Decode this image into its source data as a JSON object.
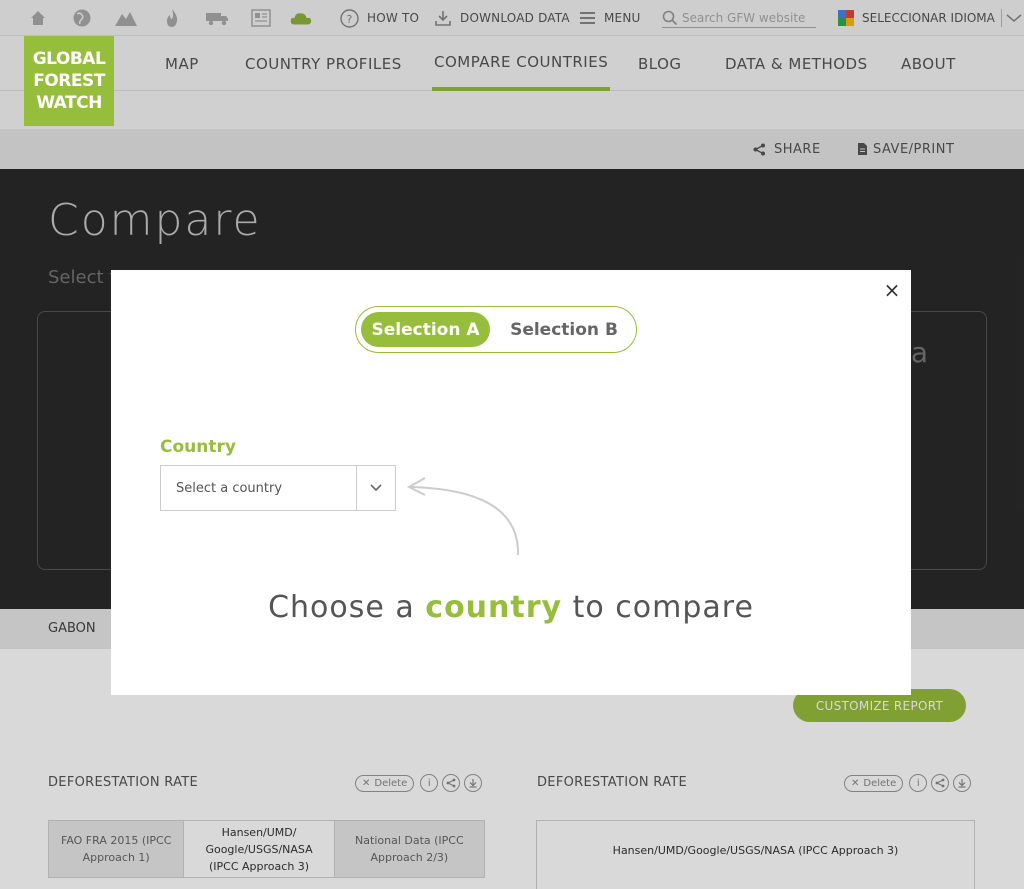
{
  "topbar": {
    "icons": [
      "home-icon",
      "globe-icon",
      "mountain-icon",
      "fire-icon",
      "truck-icon",
      "news-icon",
      "cloud-icon"
    ],
    "how_to": "HOW TO",
    "download": "DOWNLOAD DATA",
    "menu": "MENU",
    "search_placeholder": "Search GFW website",
    "language": "SELECCIONAR IDIOMA"
  },
  "logo": {
    "line1": "GLOBAL",
    "line2": "FOREST",
    "line3": "WATCH"
  },
  "nav": {
    "items": [
      "MAP",
      "COUNTRY PROFILES",
      "COMPARE COUNTRIES",
      "BLOG",
      "DATA & METHODS",
      "ABOUT"
    ],
    "active": "COMPARE COUNTRIES"
  },
  "actions": {
    "share": "SHARE",
    "save_print": "SAVE/PRINT"
  },
  "page": {
    "heading": "Compare",
    "subtitle": "Select t",
    "panel_partial": "a",
    "country_label": "GABON"
  },
  "report": {
    "customize": "CUSTOMIZE REPORT",
    "left": {
      "title": "DEFORESTATION RATE",
      "delete": "Delete",
      "tabs": [
        "FAO FRA 2015 (IPCC Approach 1)",
        "Hansen/UMD/ Google/USGS/NASA (IPCC Approach 3)",
        "National Data (IPCC Approach 2/3)"
      ]
    },
    "right": {
      "title": "DEFORESTATION RATE",
      "delete": "Delete",
      "tab": "Hansen/UMD/Google/USGS/NASA (IPCC Approach 3)"
    }
  },
  "modal": {
    "close": "×",
    "selection_a": "Selection A",
    "selection_b": "Selection B",
    "active_selection": "Selection A",
    "field_label": "Country",
    "select_placeholder": "Select a country",
    "prompt_pre": "Choose a ",
    "prompt_highlight": "country",
    "prompt_post": " to compare"
  },
  "colors": {
    "accent": "#97bd3d",
    "dark_bg": "#2a2a2a"
  }
}
